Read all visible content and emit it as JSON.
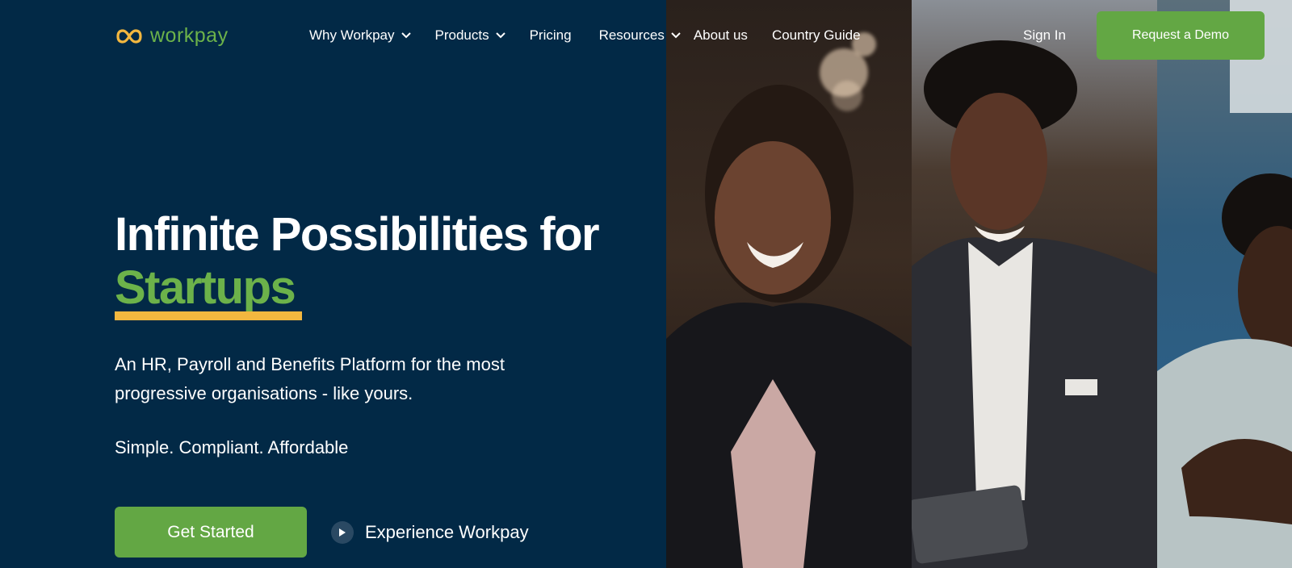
{
  "brand": {
    "name": "workpay",
    "green": "#63a744",
    "navy": "#022946",
    "accent_yellow": "#f3b73f"
  },
  "nav": {
    "items": [
      {
        "label": "Why Workpay",
        "has_dropdown": true
      },
      {
        "label": "Products",
        "has_dropdown": true
      },
      {
        "label": "Pricing",
        "has_dropdown": false
      },
      {
        "label": "Resources",
        "has_dropdown": true
      },
      {
        "label": "About us",
        "has_dropdown": false
      },
      {
        "label": "Country Guide",
        "has_dropdown": false
      }
    ],
    "sign_in": "Sign In",
    "demo_button": "Request a Demo"
  },
  "hero": {
    "headline_line1": "Infinite Possibilities for",
    "headline_line2": "Startups",
    "subtitle": "An HR, Payroll and Benefits Platform for the most progressive organisations - like yours.",
    "tagline": "Simple. Compliant. Affordable",
    "cta_primary": "Get Started",
    "cta_secondary": "Experience Workpay"
  },
  "icons": [
    "workpay-logo-icon",
    "chevron-down-icon",
    "play-icon"
  ]
}
